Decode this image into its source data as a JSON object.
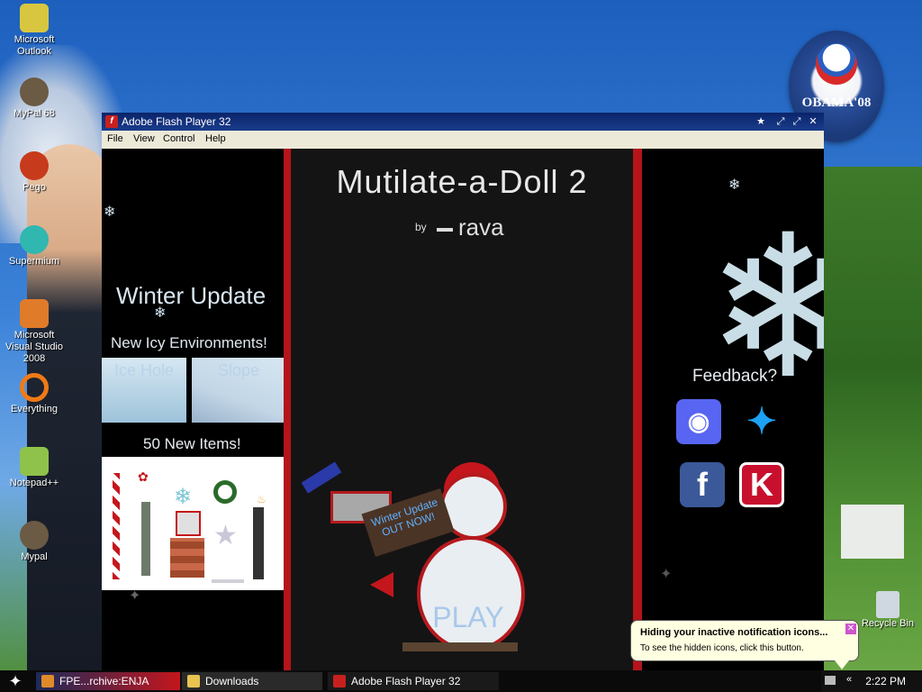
{
  "desktop": {
    "icons": [
      {
        "label": "Microsoft Outlook",
        "icon": "outlook-icon",
        "color": "#d8c640"
      },
      {
        "label": "MyPal 68",
        "icon": "raccoon-icon",
        "color": "#6b5a44"
      },
      {
        "label": "Pego",
        "icon": "pego-icon",
        "color": "#c83a1c"
      },
      {
        "label": "Supermium",
        "icon": "supermium-icon",
        "color": "#2fb7b0"
      },
      {
        "label": "Microsoft Visual Studio 2008",
        "icon": "visual-studio-icon",
        "color": "#e07b2a"
      },
      {
        "label": "Everything",
        "icon": "search-ring-icon",
        "color": "#f07a16"
      },
      {
        "label": "Notepad++",
        "icon": "notepad-icon",
        "color": "#8fc24a"
      },
      {
        "label": "Mypal",
        "icon": "raccoon-icon",
        "color": "#6b5a44"
      }
    ],
    "recycle_bin": {
      "label": "Recycle Bin"
    },
    "badge": {
      "text": "OBAMA'08"
    }
  },
  "window": {
    "title": "Adobe Flash Player 32",
    "menu": [
      "File",
      "View",
      "Control",
      "Help"
    ]
  },
  "game": {
    "title": "Mutilate-a-Doll 2",
    "by": "by",
    "author": "rava",
    "play": "PLAY",
    "sign": "Winter Update OUT NOW!",
    "left": {
      "winter_update": "Winter Update",
      "icy_title": "New Icy Environments!",
      "environments": [
        "Ice Hole",
        "Slope"
      ],
      "items_title": "50 New Items!"
    },
    "right": {
      "feedback": "Feedback?",
      "social": [
        {
          "name": "discord",
          "color": "#5865f2",
          "glyph": "◉"
        },
        {
          "name": "twitter",
          "color": "#1da1f2",
          "glyph": "✦"
        },
        {
          "name": "facebook",
          "color": "#3b5998",
          "glyph": "f"
        },
        {
          "name": "kongregate",
          "color": "#c8102e",
          "glyph": "K"
        }
      ]
    }
  },
  "taskbar": {
    "tasks": [
      "FPE...rchive:ENJA",
      "Downloads",
      "Adobe Flash Player 32"
    ],
    "clock": "2:22 PM"
  },
  "notification": {
    "title": "Hiding your inactive notification icons...",
    "message": "To see the hidden icons, click this button."
  },
  "colors": {
    "title_blue": "#0a246a",
    "accent_red": "#b5141a",
    "balloon": "#ffffe1"
  }
}
